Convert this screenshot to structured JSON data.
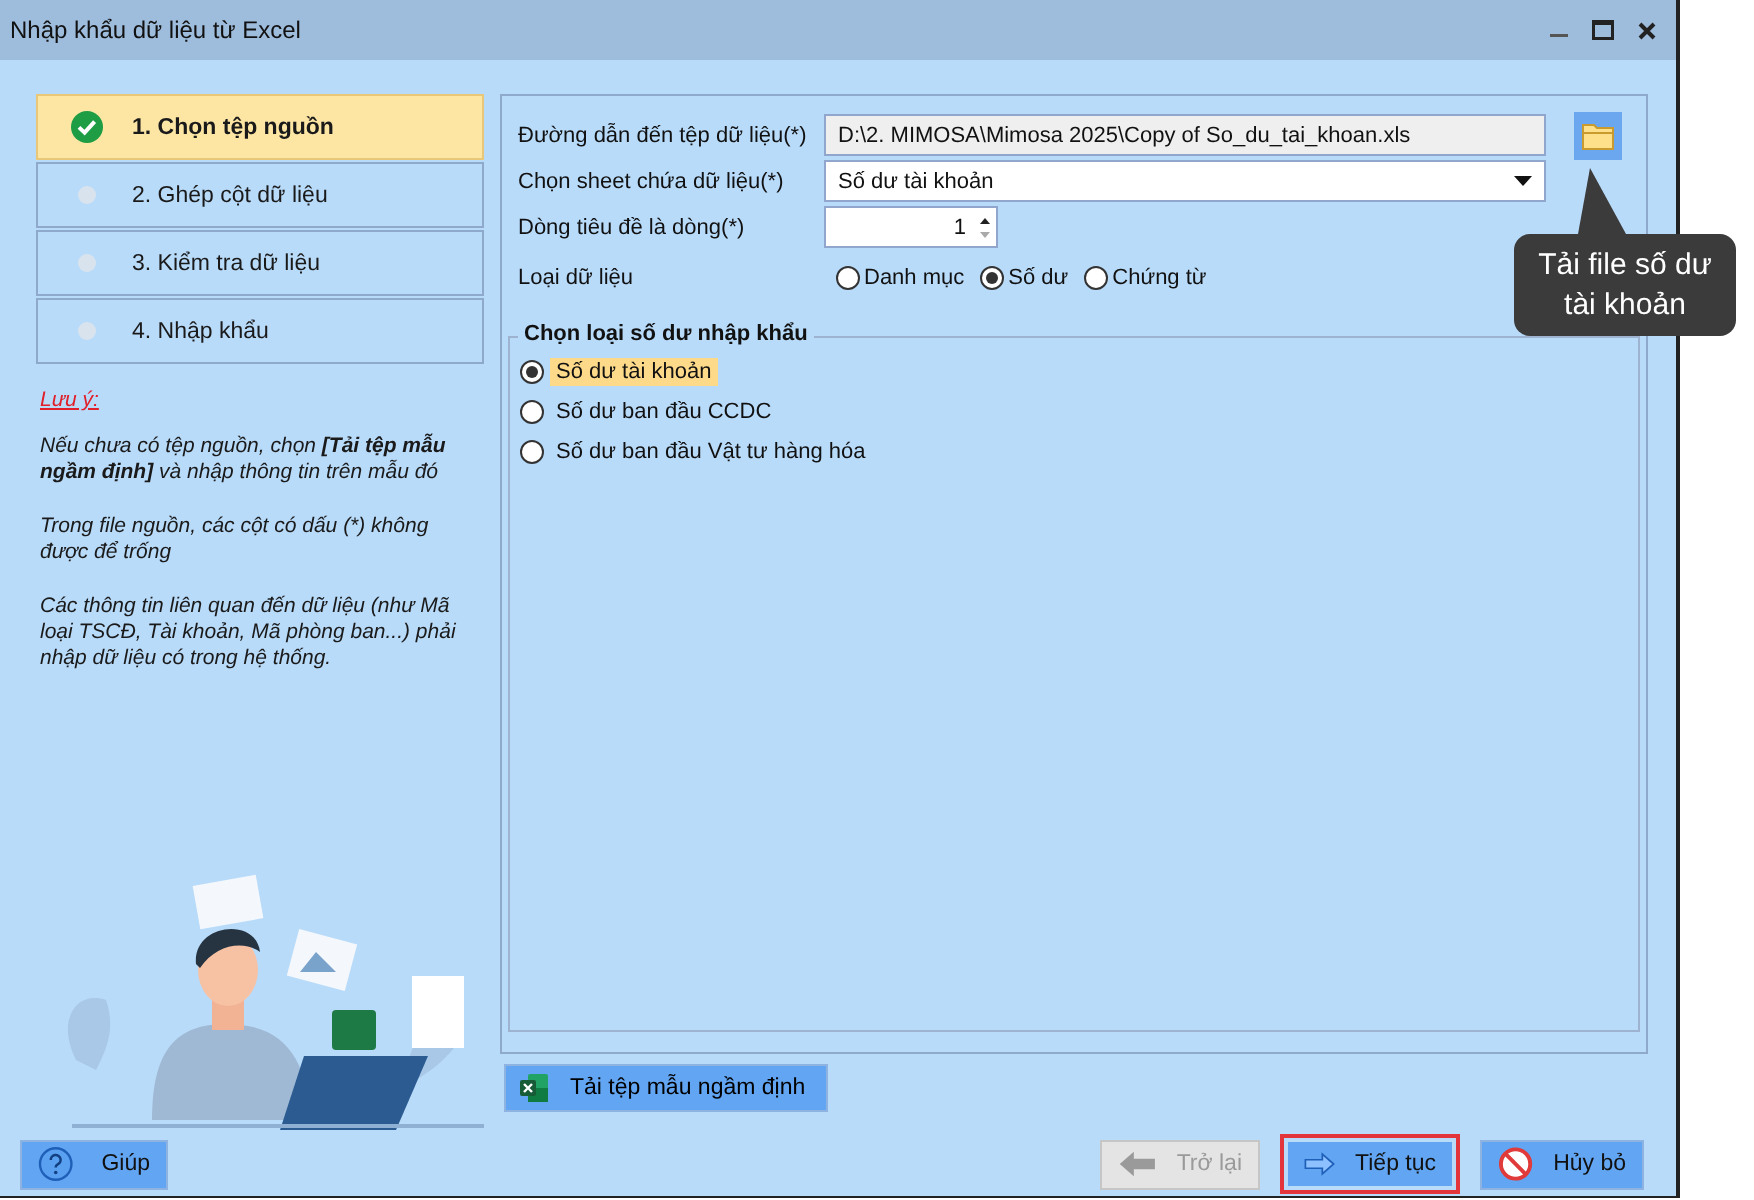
{
  "window": {
    "title": "Nhập khẩu dữ liệu từ Excel"
  },
  "steps": [
    {
      "label": "1. Chọn tệp nguồn",
      "selected": true
    },
    {
      "label": "2. Ghép cột dữ liệu",
      "selected": false
    },
    {
      "label": "3. Kiểm tra dữ liệu",
      "selected": false
    },
    {
      "label": "4. Nhập khẩu",
      "selected": false
    }
  ],
  "notes": {
    "heading": "Lưu ý:",
    "paragraphs": [
      "Nếu chưa có tệp nguồn, chọn **[Tải tệp mẫu ngầm định]** và nhập thông tin trên mẫu đó",
      "Trong file nguồn, các cột có dấu (*) không được để trống",
      "Các thông tin liên quan đến dữ liệu (như Mã loại TSCĐ, Tài khoản, Mã phòng ban...) phải nhập dữ liệu có trong hệ thống."
    ]
  },
  "form": {
    "path": {
      "label": "Đường dẫn đến tệp dữ liệu(*)",
      "value": "D:\\2. MIMOSA\\Mimosa 2025\\Copy of So_du_tai_khoan.xls"
    },
    "sheet": {
      "label": "Chọn sheet chứa dữ liệu(*)",
      "value": "Số dư tài khoản"
    },
    "header_row": {
      "label": "Dòng tiêu đề là dòng(*)",
      "value": "1"
    },
    "data_type": {
      "label": "Loại dữ liệu",
      "options": [
        {
          "label": "Danh mục",
          "selected": false
        },
        {
          "label": "Số dư",
          "selected": true
        },
        {
          "label": "Chứng từ",
          "selected": false
        }
      ]
    }
  },
  "tooltip": {
    "text": "Tải file số dư tài khoản"
  },
  "balance_group": {
    "title": "Chọn loại số dư nhập khẩu",
    "options": [
      {
        "label": "Số dư tài khoản",
        "selected": true
      },
      {
        "label": "Số dư ban đầu CCDC",
        "selected": false
      },
      {
        "label": "Số dư ban đầu Vật tư hàng hóa",
        "selected": false
      }
    ]
  },
  "template_button": {
    "label": "Tải tệp mẫu ngầm định"
  },
  "buttons": [
    {
      "label": "Giúp",
      "kind": "help",
      "disabled": false,
      "focused": false
    },
    {
      "label": "Trở lại",
      "kind": "back",
      "disabled": true,
      "focused": false
    },
    {
      "label": "Tiếp tục",
      "kind": "next",
      "disabled": false,
      "focused": true
    },
    {
      "label": "Hủy bỏ",
      "kind": "cancel",
      "disabled": false,
      "focused": false
    }
  ]
}
